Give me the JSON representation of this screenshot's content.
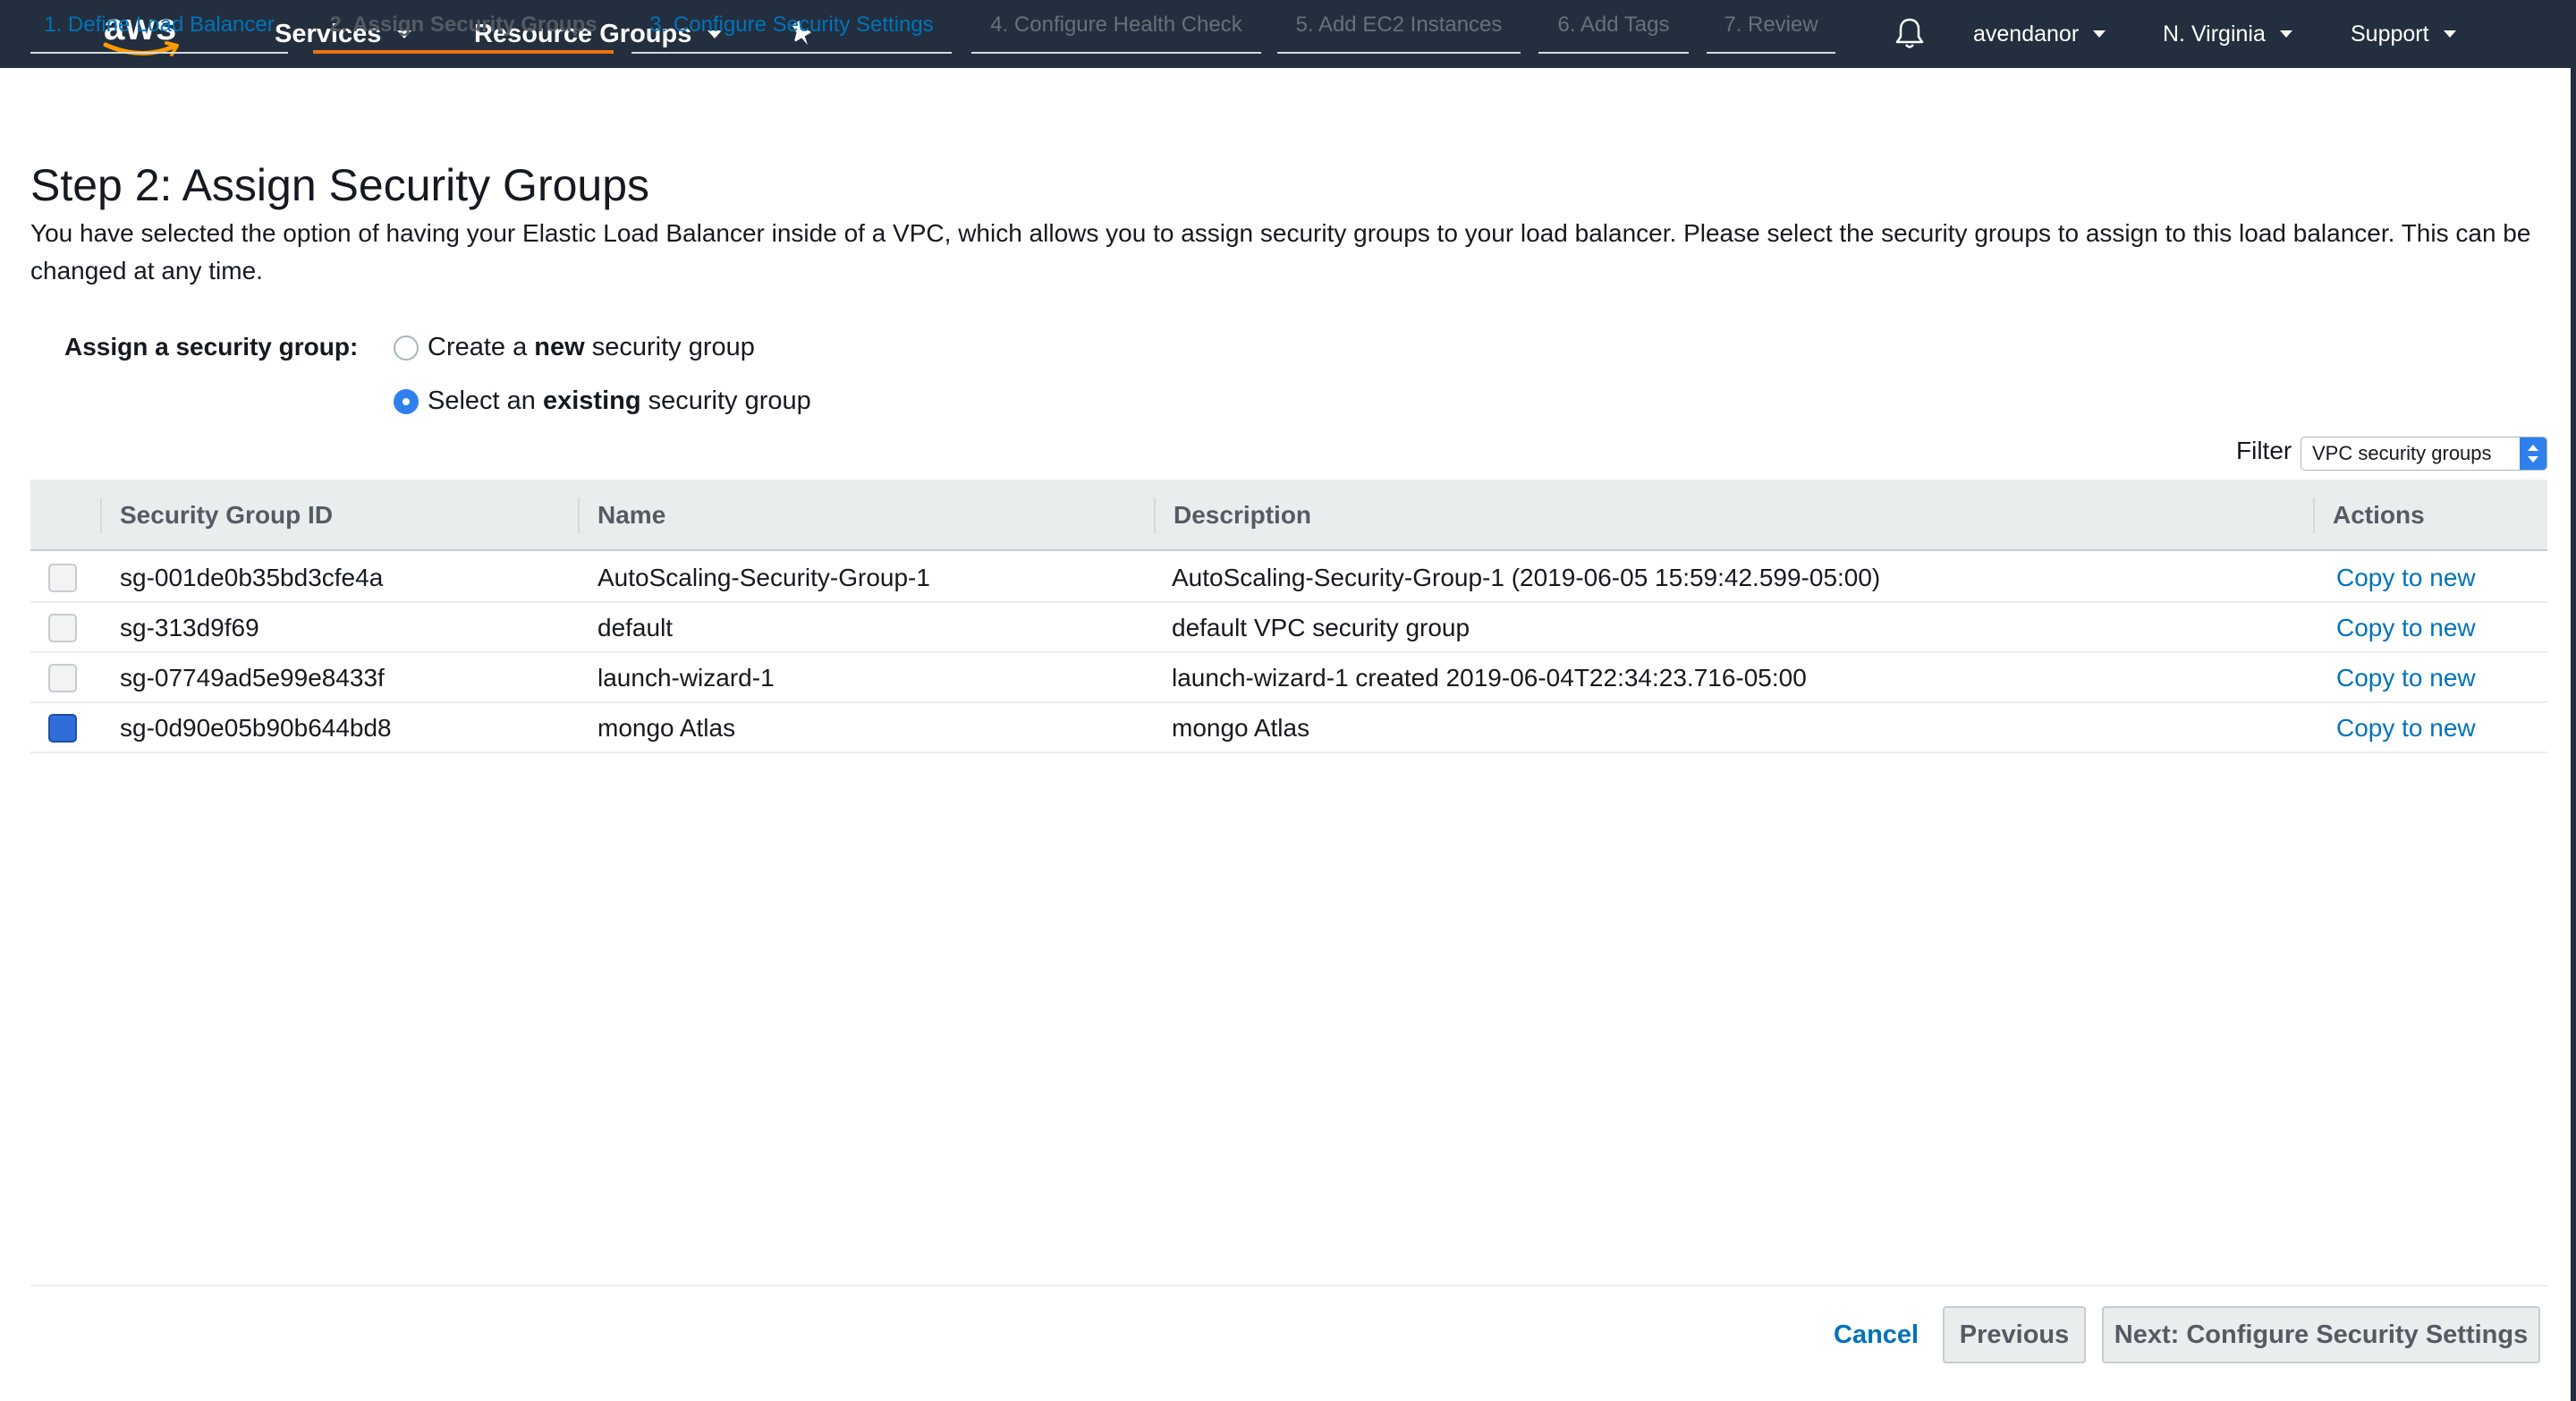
{
  "nav": {
    "logo_text": "aws",
    "services": "Services",
    "resource_groups": "Resource Groups",
    "user": "avendanor",
    "region": "N. Virginia",
    "support": "Support"
  },
  "tabs": [
    {
      "label": "1. Define Load Balancer"
    },
    {
      "label": "2. Assign Security Groups"
    },
    {
      "label": "3. Configure Security Settings"
    },
    {
      "label": "4. Configure Health Check"
    },
    {
      "label": "5. Add EC2 Instances"
    },
    {
      "label": "6. Add Tags"
    },
    {
      "label": "7. Review"
    }
  ],
  "page": {
    "title": "Step 2: Assign Security Groups",
    "description": "You have selected the option of having your Elastic Load Balancer inside of a VPC, which allows you to assign security groups to your load balancer. Please select the security groups to assign to this load balancer. This can be changed at any time."
  },
  "assign": {
    "label": "Assign a security group:",
    "option_new_pre": "Create a ",
    "option_new_bold": "new",
    "option_new_post": " security group",
    "option_existing_pre": "Select an ",
    "option_existing_bold": "existing",
    "option_existing_post": " security group",
    "selected": "existing"
  },
  "filter": {
    "label": "Filter",
    "value": "VPC security groups"
  },
  "table": {
    "headers": [
      "Security Group ID",
      "Name",
      "Description",
      "Actions"
    ],
    "rows": [
      {
        "id": "sg-001de0b35bd3cfe4a",
        "name": "AutoScaling-Security-Group-1",
        "description": "AutoScaling-Security-Group-1 (2019-06-05 15:59:42.599-05:00)",
        "action": "Copy to new",
        "checked": false
      },
      {
        "id": "sg-313d9f69",
        "name": "default",
        "description": "default VPC security group",
        "action": "Copy to new",
        "checked": false
      },
      {
        "id": "sg-07749ad5e99e8433f",
        "name": "launch-wizard-1",
        "description": "launch-wizard-1 created 2019-06-04T22:34:23.716-05:00",
        "action": "Copy to new",
        "checked": false
      },
      {
        "id": "sg-0d90e05b90b644bd8",
        "name": "mongo Atlas",
        "description": "mongo Atlas",
        "action": "Copy to new",
        "checked": true
      }
    ]
  },
  "footer": {
    "cancel": "Cancel",
    "previous": "Previous",
    "next": "Next: Configure Security Settings"
  },
  "colors": {
    "navbar": "#232f3e",
    "link": "#0073bb",
    "active_tab_underline": "#ec7211",
    "selected_control": "#2f80ed"
  },
  "icons": {
    "bell": "bell-icon",
    "pin": "pin-icon"
  }
}
